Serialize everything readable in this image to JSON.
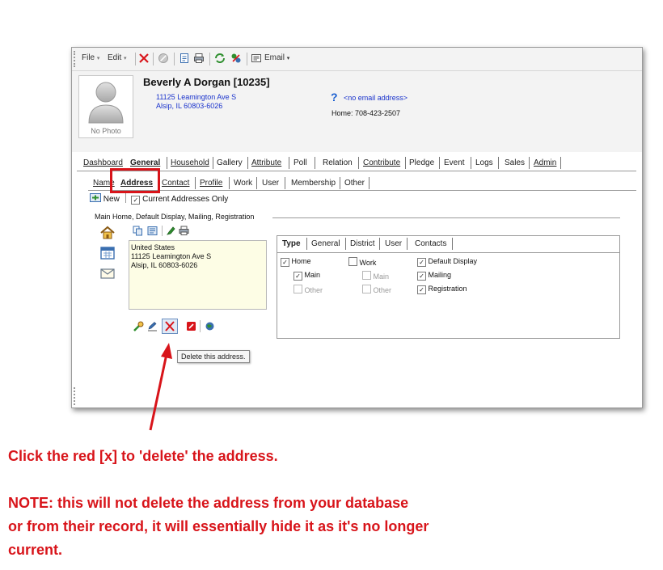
{
  "toolbar": {
    "file_label": "File",
    "edit_label": "Edit",
    "email_label": "Email",
    "icons": [
      "delete-icon",
      "disabled-icon",
      "document-icon",
      "print-icon",
      "refresh-icon",
      "tools-icon",
      "email-icon"
    ]
  },
  "record": {
    "name": "Beverly A Dorgan  [10235]",
    "address_line1": "11125 Leamington Ave S",
    "address_line2": "Alsip, IL 60803-6026",
    "email": "<no email address>",
    "phone": "Home: 708-423-2507",
    "photo_label": "No Photo"
  },
  "main_tabs": [
    "Dashboard",
    "General",
    "Household",
    "Gallery",
    "Attribute",
    "Poll",
    "Relation",
    "Contribute",
    "Pledge",
    "Event",
    "Logs",
    "Sales",
    "Admin"
  ],
  "sub_tabs": [
    "Name",
    "Address",
    "Contact",
    "Profile",
    "Work",
    "User",
    "Membership",
    "Other"
  ],
  "address_bar": {
    "new_label": "New",
    "current_only_label": "Current Addresses Only"
  },
  "address_group": {
    "title": "Main Home, Default Display, Mailing, Registration",
    "lines": [
      "United States",
      "11125 Leamington Ave S",
      "Alsip, IL  60803-6026"
    ]
  },
  "type_tabs": [
    "Type",
    "General",
    "District",
    "User",
    "Contacts"
  ],
  "type_options": {
    "home": "Home",
    "work": "Work",
    "default_display": "Default Display",
    "main": "Main",
    "other": "Other",
    "mailing": "Mailing",
    "registration": "Registration"
  },
  "tooltip": "Delete this address.",
  "note": {
    "line1": "Click the red [x] to 'delete' the address.",
    "line2": "NOTE: this will not delete the address from your database",
    "line3": "or from their record, it will essentially hide it as it's no longer",
    "line4": "current."
  },
  "colors": {
    "annotation_red": "#d8141a",
    "link_blue": "#1a33cc",
    "address_box": "#fdfde5"
  }
}
